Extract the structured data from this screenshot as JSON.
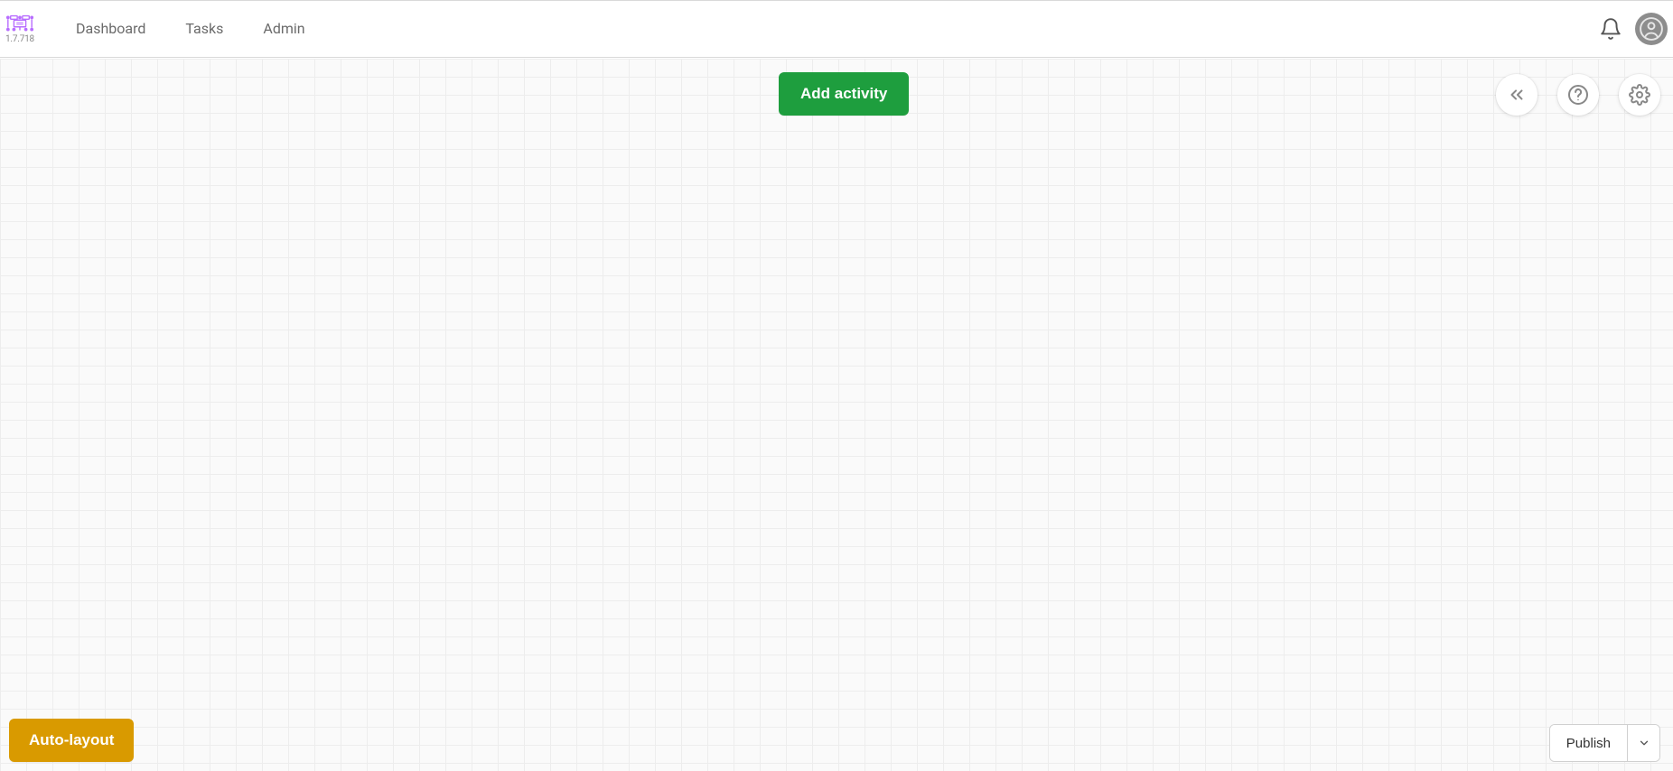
{
  "app": {
    "version": "1.7.718"
  },
  "nav": {
    "items": [
      {
        "label": "Dashboard"
      },
      {
        "label": "Tasks"
      },
      {
        "label": "Admin"
      }
    ]
  },
  "header_icons": {
    "notifications": "bell-icon",
    "user": "user-avatar"
  },
  "main": {
    "add_activity_label": "Add activity"
  },
  "float_toolbar": {
    "collapse": "double-chevron-left-icon",
    "help": "help-icon",
    "settings": "gear-icon"
  },
  "footer": {
    "auto_layout_label": "Auto-layout",
    "publish_label": "Publish"
  },
  "colors": {
    "primary_green": "#1e9e3e",
    "warning_amber": "#d99a00",
    "grid_bg": "#fafafa",
    "grid_line": "#ededed"
  }
}
